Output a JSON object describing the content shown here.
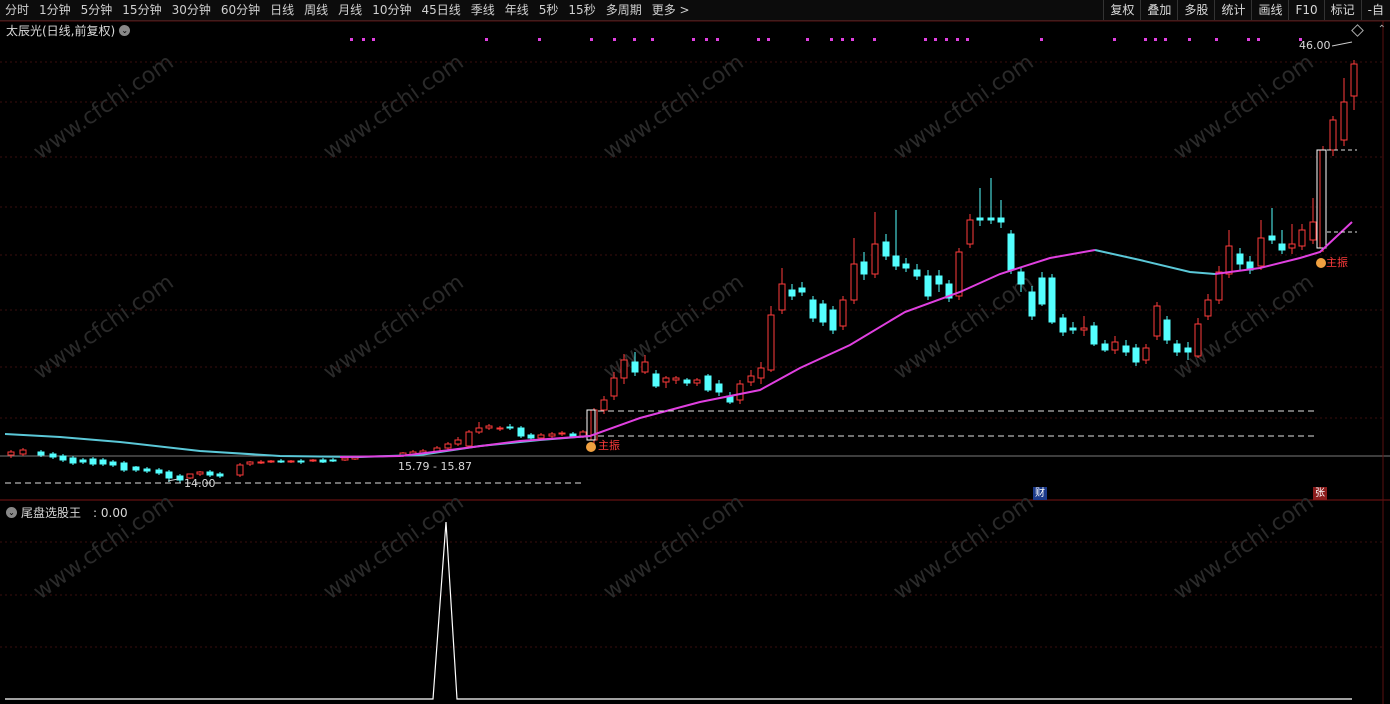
{
  "toolbar": {
    "periods": [
      "分时",
      "1分钟",
      "5分钟",
      "15分钟",
      "30分钟",
      "60分钟",
      "日线",
      "周线",
      "月线",
      "10分钟",
      "45日线",
      "季线",
      "年线",
      "5秒",
      "15秒",
      "多周期",
      "更多 >"
    ],
    "tools": [
      "复权",
      "叠加",
      "多股",
      "统计",
      "画线",
      "F10",
      "标记",
      "-自"
    ]
  },
  "main": {
    "title": "太辰光(日线,前复权)",
    "high_label": "46.00",
    "low_label": "14.00",
    "range_label": "15.79 - 15.87",
    "tag1": "主振",
    "tag2": "主振",
    "badge_cai": "财",
    "badge_zhang": "张"
  },
  "sub": {
    "title": "尾盘选股王",
    "value": ": 0.00"
  },
  "watermark": "www.cfchi.com",
  "colors": {
    "up": "#ff3b3b",
    "down": "#54ffff",
    "ma": "#e040e0",
    "ma_tail": "#5bc8d8",
    "grid": "#3a0e0e",
    "indicator": "#ffffff",
    "marker": "#e040e0"
  }
}
